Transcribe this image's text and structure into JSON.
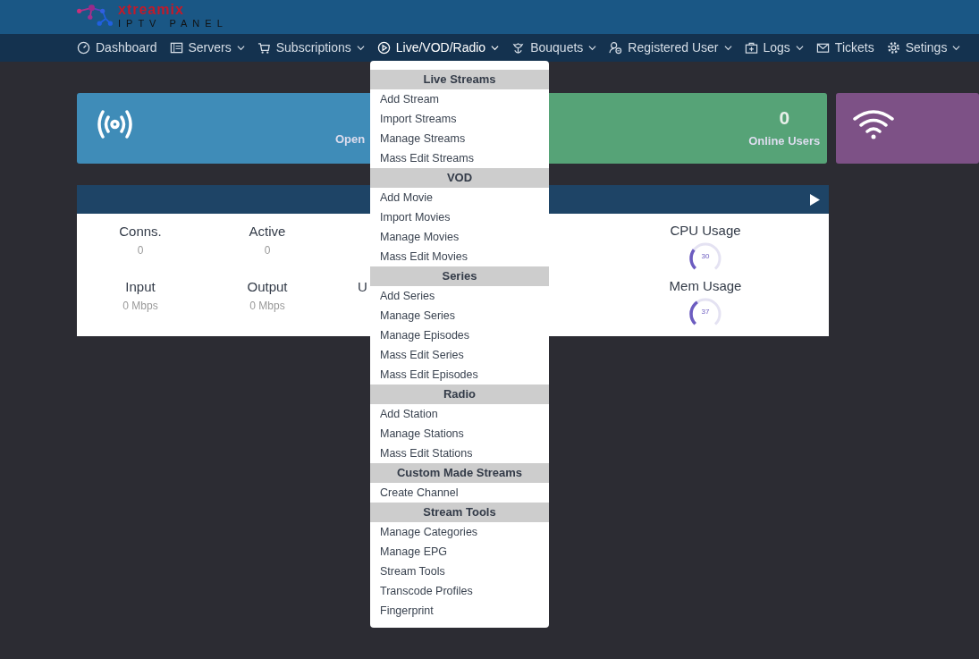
{
  "logo": {
    "name": "xtreamix",
    "tagline": "IPTV PANEL"
  },
  "nav": [
    {
      "label": "Dashboard",
      "dropdown": false,
      "selected": false
    },
    {
      "label": "Servers",
      "dropdown": true,
      "selected": false
    },
    {
      "label": "Subscriptions",
      "dropdown": true,
      "selected": false
    },
    {
      "label": "Live/VOD/Radio",
      "dropdown": true,
      "selected": true
    },
    {
      "label": "Bouquets",
      "dropdown": true,
      "selected": false
    },
    {
      "label": "Registered User",
      "dropdown": true,
      "selected": false
    },
    {
      "label": "Logs",
      "dropdown": true,
      "selected": false
    },
    {
      "label": "Tickets",
      "dropdown": false,
      "selected": false
    },
    {
      "label": "Setings",
      "dropdown": true,
      "selected": false
    }
  ],
  "stat_cards": [
    {
      "kind": "broadcast",
      "color": "#3f8cb8",
      "label": "Open"
    },
    {
      "kind": "number",
      "color": "#56a377",
      "value": "0",
      "label": "Online Users"
    },
    {
      "kind": "wifi",
      "color": "#7d5186"
    }
  ],
  "server_panel": {
    "rows": [
      [
        {
          "label": "Conns.",
          "value": "0"
        },
        {
          "label": "Active",
          "value": "0"
        }
      ],
      [
        {
          "label": "Input",
          "value": "0 Mbps"
        },
        {
          "label": "Output",
          "value": "0 Mbps"
        },
        {
          "label": "U"
        }
      ]
    ],
    "gauges": [
      {
        "label": "CPU Usage",
        "reading": "30",
        "level": 0.3
      },
      {
        "label": "Mem Usage",
        "reading": "37",
        "level": 0.37
      }
    ]
  },
  "menu": {
    "sections": [
      {
        "title": "Live Streams",
        "items": [
          "Add Stream",
          "Import Streams",
          "Manage Streams",
          "Mass Edit Streams"
        ]
      },
      {
        "title": "VOD",
        "items": [
          "Add Movie",
          "Import Movies",
          "Manage Movies",
          "Mass Edit Movies"
        ]
      },
      {
        "title": "Series",
        "items": [
          "Add Series",
          "Manage Series",
          "Manage Episodes",
          "Mass Edit Series",
          "Mass Edit Episodes"
        ]
      },
      {
        "title": "Radio",
        "items": [
          "Add Station",
          "Manage Stations",
          "Mass Edit Stations"
        ]
      },
      {
        "title": "Custom Made Streams",
        "items": [
          "Create Channel"
        ]
      },
      {
        "title": "Stream Tools",
        "items": [
          "Manage Categories",
          "Manage EPG",
          "Stream Tools",
          "Transcode Profiles",
          "Fingerprint"
        ]
      }
    ]
  }
}
